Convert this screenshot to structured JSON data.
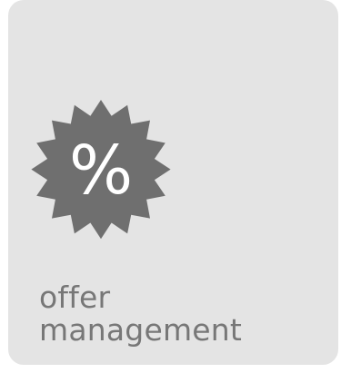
{
  "tile": {
    "icon": "percent-badge-icon",
    "symbol": "%",
    "label_line1": "offer",
    "label_line2": "management"
  },
  "colors": {
    "tile_background": "#e4e4e4",
    "badge": "#6f6f6f",
    "symbol": "#ffffff",
    "label": "#777777"
  }
}
